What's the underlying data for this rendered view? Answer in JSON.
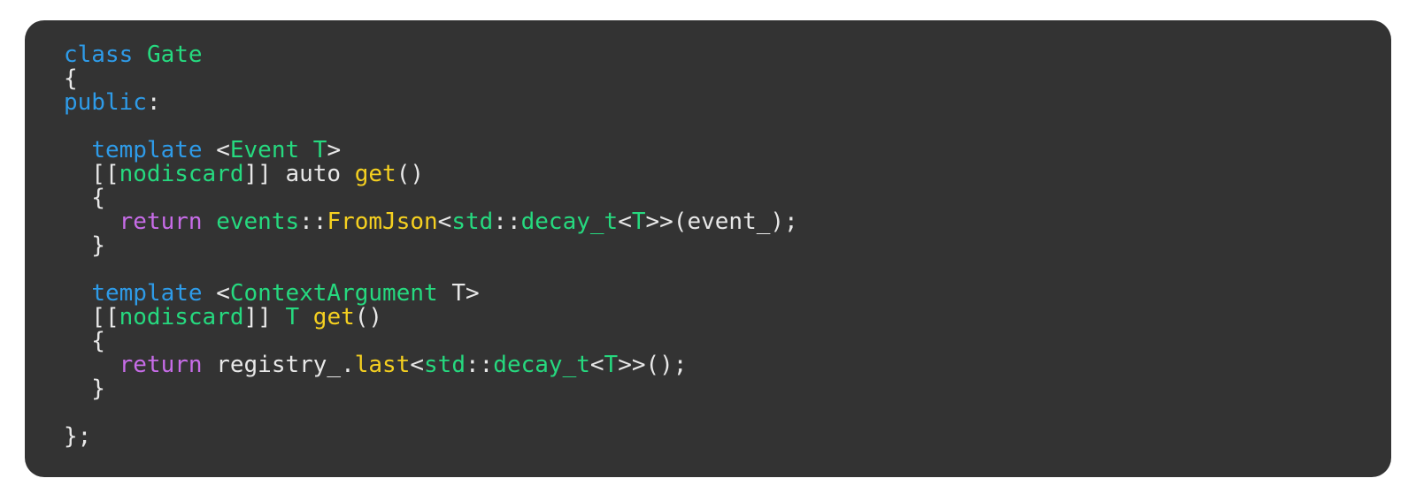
{
  "panel": {
    "background_color": "#333333",
    "corner_radius_px": 22,
    "language": "cpp"
  },
  "theme": {
    "keyword_color": "#2E9BE8",
    "type_color": "#26D97F",
    "function_color": "#F5D020",
    "control_color": "#C76CE8",
    "plain_color": "#E8E8E8",
    "page_background": "#ffffff"
  },
  "code": {
    "plain_text": "class Gate\n{\npublic:\n\n  template <Event T>\n  [[nodiscard]] auto get()\n  {\n    return events::FromJson<std::decay_t<T>>(event_);\n  }\n\n  template <ContextArgument T>\n  [[nodiscard]] T get()\n  {\n    return registry_.last<std::decay_t<T>>();\n  }\n\n};",
    "lines": [
      {
        "id": 1,
        "tokens": [
          {
            "t": "class",
            "c": "kw"
          },
          {
            "t": " ",
            "c": "pl"
          },
          {
            "t": "Gate",
            "c": "type"
          }
        ]
      },
      {
        "id": 2,
        "tokens": [
          {
            "t": "{",
            "c": "pl"
          }
        ]
      },
      {
        "id": 3,
        "tokens": [
          {
            "t": "public",
            "c": "kw"
          },
          {
            "t": ":",
            "c": "pl"
          }
        ]
      },
      {
        "id": 4,
        "tokens": []
      },
      {
        "id": 5,
        "tokens": [
          {
            "t": "  ",
            "c": "pl"
          },
          {
            "t": "template",
            "c": "kw"
          },
          {
            "t": " <",
            "c": "pl"
          },
          {
            "t": "Event",
            "c": "type"
          },
          {
            "t": " ",
            "c": "pl"
          },
          {
            "t": "T",
            "c": "type"
          },
          {
            "t": ">",
            "c": "pl"
          }
        ]
      },
      {
        "id": 6,
        "tokens": [
          {
            "t": "  [[",
            "c": "pl"
          },
          {
            "t": "nodiscard",
            "c": "type"
          },
          {
            "t": "]] auto ",
            "c": "pl"
          },
          {
            "t": "get",
            "c": "fn"
          },
          {
            "t": "()",
            "c": "pl"
          }
        ]
      },
      {
        "id": 7,
        "tokens": [
          {
            "t": "  {",
            "c": "pl"
          }
        ]
      },
      {
        "id": 8,
        "tokens": [
          {
            "t": "    ",
            "c": "pl"
          },
          {
            "t": "return",
            "c": "ctl"
          },
          {
            "t": " ",
            "c": "pl"
          },
          {
            "t": "events",
            "c": "type"
          },
          {
            "t": "::",
            "c": "pl"
          },
          {
            "t": "FromJson",
            "c": "fn"
          },
          {
            "t": "<",
            "c": "pl"
          },
          {
            "t": "std",
            "c": "type"
          },
          {
            "t": "::",
            "c": "pl"
          },
          {
            "t": "decay_t",
            "c": "type"
          },
          {
            "t": "<",
            "c": "pl"
          },
          {
            "t": "T",
            "c": "type"
          },
          {
            "t": ">>(event_);",
            "c": "pl"
          }
        ]
      },
      {
        "id": 9,
        "tokens": [
          {
            "t": "  }",
            "c": "pl"
          }
        ]
      },
      {
        "id": 10,
        "tokens": []
      },
      {
        "id": 11,
        "tokens": [
          {
            "t": "  ",
            "c": "pl"
          },
          {
            "t": "template",
            "c": "kw"
          },
          {
            "t": " <",
            "c": "pl"
          },
          {
            "t": "ContextArgument",
            "c": "type"
          },
          {
            "t": " T>",
            "c": "pl"
          }
        ]
      },
      {
        "id": 12,
        "tokens": [
          {
            "t": "  [[",
            "c": "pl"
          },
          {
            "t": "nodiscard",
            "c": "type"
          },
          {
            "t": "]] ",
            "c": "pl"
          },
          {
            "t": "T",
            "c": "type"
          },
          {
            "t": " ",
            "c": "pl"
          },
          {
            "t": "get",
            "c": "fn"
          },
          {
            "t": "()",
            "c": "pl"
          }
        ]
      },
      {
        "id": 13,
        "tokens": [
          {
            "t": "  {",
            "c": "pl"
          }
        ]
      },
      {
        "id": 14,
        "tokens": [
          {
            "t": "    ",
            "c": "pl"
          },
          {
            "t": "return",
            "c": "ctl"
          },
          {
            "t": " registry_.",
            "c": "pl"
          },
          {
            "t": "last",
            "c": "fn"
          },
          {
            "t": "<",
            "c": "pl"
          },
          {
            "t": "std",
            "c": "type"
          },
          {
            "t": "::",
            "c": "pl"
          },
          {
            "t": "decay_t",
            "c": "type"
          },
          {
            "t": "<",
            "c": "pl"
          },
          {
            "t": "T",
            "c": "type"
          },
          {
            "t": ">>();",
            "c": "pl"
          }
        ]
      },
      {
        "id": 15,
        "tokens": [
          {
            "t": "  }",
            "c": "pl"
          }
        ]
      },
      {
        "id": 16,
        "tokens": []
      },
      {
        "id": 17,
        "tokens": [
          {
            "t": "};",
            "c": "pl"
          }
        ]
      }
    ]
  }
}
